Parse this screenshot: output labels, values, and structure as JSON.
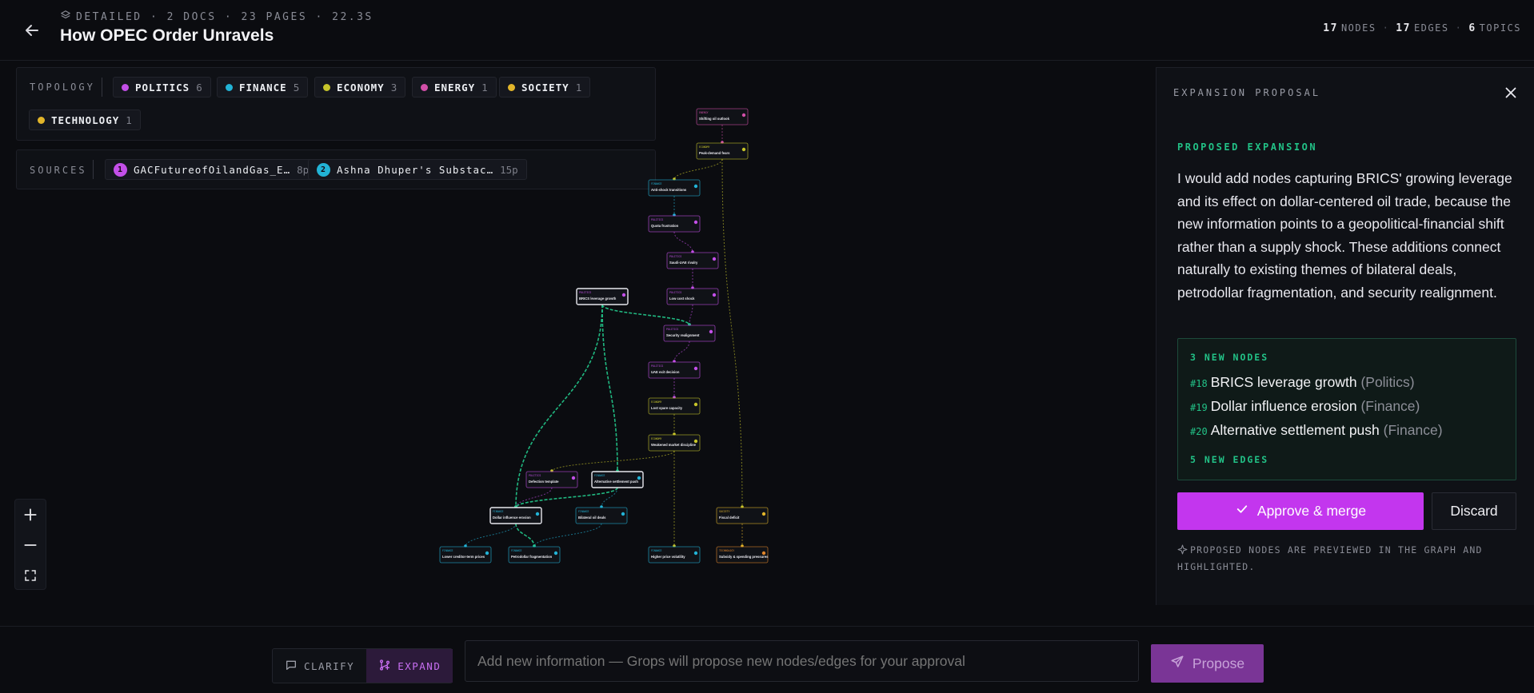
{
  "header": {
    "meta": "DETAILED · 2 DOCS · 23 PAGES · 22.3S",
    "title": "How OPEC Order Unravels",
    "stats": {
      "nodes_count": "17",
      "nodes_label": "NODES",
      "edges_count": "17",
      "edges_label": "EDGES",
      "topics_count": "6",
      "topics_label": "TOPICS"
    }
  },
  "topology": {
    "label": "TOPOLOGY",
    "chips": [
      {
        "name": "POLITICS",
        "count": "6",
        "color": "#c34fe8"
      },
      {
        "name": "FINANCE",
        "count": "5",
        "color": "#22b3d6"
      },
      {
        "name": "ECONOMY",
        "count": "3",
        "color": "#c6c42a"
      },
      {
        "name": "ENERGY",
        "count": "1",
        "color": "#d24fa8"
      },
      {
        "name": "SOCIETY",
        "count": "1",
        "color": "#e2b52a"
      },
      {
        "name": "TECHNOLOGY",
        "count": "1",
        "color": "#e2b52a"
      }
    ]
  },
  "sources": {
    "label": "SOURCES",
    "items": [
      {
        "num": "1",
        "name": "GACFutureofOilandGas_E…",
        "pages": "8p",
        "color": "#c34fe8"
      },
      {
        "num": "2",
        "name": "Ashna Dhuper's Substac…",
        "pages": "15p",
        "color": "#22b3d6"
      }
    ]
  },
  "graph": {
    "nodes": [
      {
        "id": "n1",
        "label": "Shifting oil outlook",
        "tag": "ENERGY",
        "color": "#d24fa8",
        "highlight": false
      },
      {
        "id": "n2",
        "label": "Peak-demand fears",
        "tag": "ECONOMY",
        "color": "#c6c42a",
        "highlight": false
      },
      {
        "id": "n3",
        "label": "Anti-shock transitions",
        "tag": "FINANCE",
        "color": "#22b3d6",
        "highlight": false
      },
      {
        "id": "n4",
        "label": "Quota frustration",
        "tag": "POLITICS",
        "color": "#c34fe8",
        "highlight": false
      },
      {
        "id": "n5",
        "label": "Saudi-UAE rivalry",
        "tag": "POLITICS",
        "color": "#c34fe8",
        "highlight": false
      },
      {
        "id": "n6",
        "label": "Low cost shock",
        "tag": "POLITICS",
        "color": "#c34fe8",
        "highlight": false
      },
      {
        "id": "n7",
        "label": "BRICS leverage growth",
        "tag": "POLITICS",
        "color": "#c34fe8",
        "highlight": true
      },
      {
        "id": "n8",
        "label": "Security realignment",
        "tag": "POLITICS",
        "color": "#c34fe8",
        "highlight": false
      },
      {
        "id": "n9",
        "label": "UAE exit decision",
        "tag": "POLITICS",
        "color": "#c34fe8",
        "highlight": false
      },
      {
        "id": "n10",
        "label": "Lost spare capacity",
        "tag": "ECONOMY",
        "color": "#c6c42a",
        "highlight": false
      },
      {
        "id": "n11",
        "label": "Weakened market discipline",
        "tag": "ECONOMY",
        "color": "#c6c42a",
        "highlight": false
      },
      {
        "id": "n12",
        "label": "Defection template",
        "tag": "POLITICS",
        "color": "#c34fe8",
        "highlight": false
      },
      {
        "id": "n13",
        "label": "Alternative settlement push",
        "tag": "FINANCE",
        "color": "#22b3d6",
        "highlight": true
      },
      {
        "id": "n14",
        "label": "Dollar influence erosion",
        "tag": "FINANCE",
        "color": "#22b3d6",
        "highlight": true
      },
      {
        "id": "n15",
        "label": "Bilateral oil deals",
        "tag": "FINANCE",
        "color": "#22b3d6",
        "highlight": false
      },
      {
        "id": "n16",
        "label": "Fiscal deficit",
        "tag": "SOCIETY",
        "color": "#e2b52a",
        "highlight": false
      },
      {
        "id": "n17",
        "label": "Lower creditor-term prices",
        "tag": "FINANCE",
        "color": "#22b3d6",
        "highlight": false
      },
      {
        "id": "n18",
        "label": "Petrodollar fragmentation",
        "tag": "FINANCE",
        "color": "#22b3d6",
        "highlight": false
      },
      {
        "id": "n19",
        "label": "Higher price volatility",
        "tag": "FINANCE",
        "color": "#22b3d6",
        "highlight": false
      },
      {
        "id": "n20",
        "label": "Subsidy & spending pressures",
        "tag": "TECHNOLOGY",
        "color": "#e0852a",
        "highlight": false
      }
    ],
    "edges": [
      {
        "from": "n1",
        "to": "n2",
        "color": "#d24fa8",
        "proposed": false
      },
      {
        "from": "n2",
        "to": "n3",
        "color": "#c6c42a",
        "proposed": false
      },
      {
        "from": "n2",
        "to": "n16",
        "color": "#c6c42a",
        "proposed": false
      },
      {
        "from": "n3",
        "to": "n4",
        "color": "#22b3d6",
        "proposed": false
      },
      {
        "from": "n4",
        "to": "n5",
        "color": "#c34fe8",
        "proposed": false
      },
      {
        "from": "n5",
        "to": "n6",
        "color": "#c34fe8",
        "proposed": false
      },
      {
        "from": "n6",
        "to": "n8",
        "color": "#c34fe8",
        "proposed": false
      },
      {
        "from": "n8",
        "to": "n9",
        "color": "#c34fe8",
        "proposed": false
      },
      {
        "from": "n9",
        "to": "n10",
        "color": "#c34fe8",
        "proposed": false
      },
      {
        "from": "n10",
        "to": "n11",
        "color": "#c6c42a",
        "proposed": false
      },
      {
        "from": "n11",
        "to": "n12",
        "color": "#c6c42a",
        "proposed": false
      },
      {
        "from": "n11",
        "to": "n19",
        "color": "#c6c42a",
        "proposed": false
      },
      {
        "from": "n12",
        "to": "n14",
        "color": "#c34fe8",
        "proposed": false
      },
      {
        "from": "n15",
        "to": "n18",
        "color": "#22b3d6",
        "proposed": false
      },
      {
        "from": "n14",
        "to": "n17",
        "color": "#22b3d6",
        "proposed": false
      },
      {
        "from": "n16",
        "to": "n20",
        "color": "#e2b52a",
        "proposed": false
      },
      {
        "from": "n13",
        "to": "n15",
        "color": "#22b3d6",
        "proposed": false
      },
      {
        "from": "n7",
        "to": "n8",
        "color": "#22c287",
        "proposed": true
      },
      {
        "from": "n7",
        "to": "n14",
        "color": "#22c287",
        "proposed": true
      },
      {
        "from": "n7",
        "to": "n13",
        "color": "#22c287",
        "proposed": true
      },
      {
        "from": "n14",
        "to": "n18",
        "color": "#22c287",
        "proposed": true
      },
      {
        "from": "n13",
        "to": "n14",
        "color": "#22c287",
        "proposed": true
      }
    ]
  },
  "expansion": {
    "panel_title": "EXPANSION PROPOSAL",
    "label": "PROPOSED EXPANSION",
    "text": "I would add nodes capturing BRICS' growing leverage and its effect on dollar-centered oil trade, because the new information points to a geopolitical-financial shift rather than a supply shock. These additions connect naturally to existing themes of bilateral deals, petrodollar fragmentation, and security realignment.",
    "new_nodes_label": "3 NEW NODES",
    "new_nodes": [
      {
        "id": "#18",
        "name": "BRICS leverage growth",
        "category": "(Politics)"
      },
      {
        "id": "#19",
        "name": "Dollar influence erosion",
        "category": "(Finance)"
      },
      {
        "id": "#20",
        "name": "Alternative settlement push",
        "category": "(Finance)"
      }
    ],
    "new_edges_label": "5 NEW EDGES",
    "approve_label": "Approve & merge",
    "discard_label": "Discard",
    "footnote": "PROPOSED NODES ARE PREVIEWED IN THE GRAPH AND HIGHLIGHTED."
  },
  "bottom": {
    "clarify_label": "CLARIFY",
    "expand_label": "EXPAND",
    "input_placeholder": "Add new information — Grops will propose new nodes/edges for your approval",
    "propose_label": "Propose"
  }
}
